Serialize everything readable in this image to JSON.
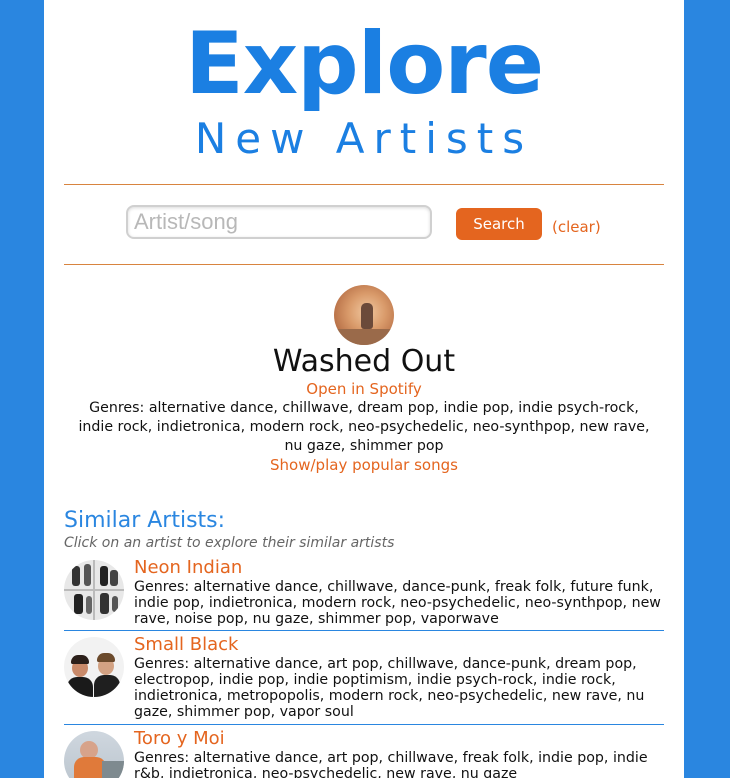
{
  "header": {
    "title": "Explore",
    "subtitle": "New Artists"
  },
  "search": {
    "placeholder": "Artist/song",
    "value": "",
    "button_label": "Search",
    "clear_label": "(clear)"
  },
  "artist": {
    "name": "Washed Out",
    "spotify_link": "Open in Spotify",
    "genres": "Genres: alternative dance, chillwave, dream pop, indie pop, indie psych-rock, indie rock, indietronica, modern rock, neo-psychedelic, neo-synthpop, new rave, nu gaze, shimmer pop",
    "popular_link": "Show/play popular songs"
  },
  "similar": {
    "heading": "Similar Artists:",
    "hint": "Click on an artist to explore their similar artists",
    "items": [
      {
        "name": "Neon Indian",
        "genres": "Genres: alternative dance, chillwave, dance-punk, freak folk, future funk, indie pop, indietronica, modern rock, neo-psychedelic, neo-synthpop, new rave, noise pop, nu gaze, shimmer pop, vaporwave"
      },
      {
        "name": "Small Black",
        "genres": "Genres: alternative dance, art pop, chillwave, dance-punk, dream pop, electropop, indie pop, indie poptimism, indie psych-rock, indie rock, indietronica, metropopolis, modern rock, neo-psychedelic, new rave, nu gaze, shimmer pop, vapor soul"
      },
      {
        "name": "Toro y Moi",
        "genres": "Genres: alternative dance, art pop, chillwave, freak folk, indie pop, indie r&b, indietronica, neo-psychedelic, new rave, nu gaze"
      }
    ]
  },
  "colors": {
    "brand_blue": "#2a86e0",
    "accent_orange": "#e4651f"
  }
}
